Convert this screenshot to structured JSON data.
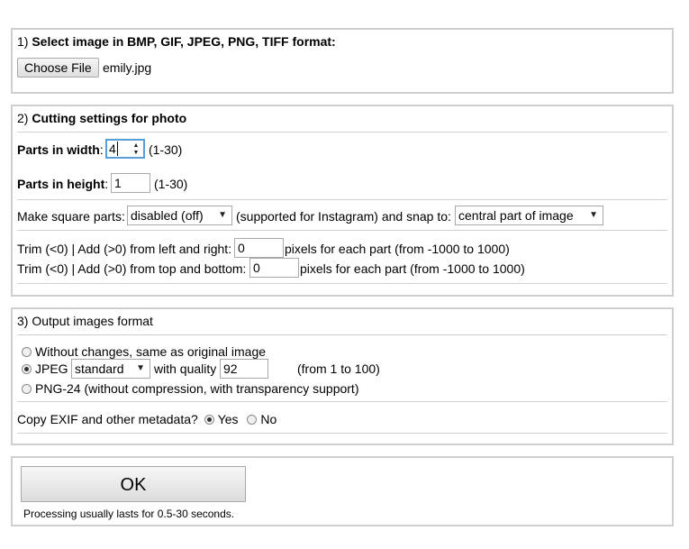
{
  "section1": {
    "num": "1)",
    "title": "Select image in BMP, GIF, JPEG, PNG, TIFF format:",
    "choose_button": "Choose File",
    "file_name": "emily.jpg"
  },
  "section2": {
    "num": "2)",
    "title": "Cutting settings for photo",
    "width_label": "Parts in width",
    "width_value": "4",
    "width_range": "(1-30)",
    "height_label": "Parts in height",
    "height_value": "1",
    "height_range": "(1-30)",
    "square_label": "Make square parts:",
    "square_value": "disabled (off)",
    "square_note": "(supported for Instagram) and snap to:",
    "snap_value": "central part of image",
    "trim_lr_label": "Trim (<0) | Add (>0) from left and right:",
    "trim_lr_value": "0",
    "trim_lr_suffix": "pixels for each part (from -1000 to 1000)",
    "trim_tb_label": "Trim (<0) | Add (>0) from top and bottom:",
    "trim_tb_value": "0",
    "trim_tb_suffix": "pixels for each part (from -1000 to 1000)"
  },
  "section3": {
    "title": "3) Output images format",
    "opt_original": "Without changes, same as original image",
    "opt_jpeg": "JPEG",
    "jpeg_mode": "standard",
    "quality_label": "with quality",
    "quality_value": "92",
    "quality_range": "(from 1 to 100)",
    "opt_png": "PNG-24 (without compression, with transparency support)",
    "exif_label": "Copy EXIF and other metadata?",
    "exif_yes": "Yes",
    "exif_no": "No"
  },
  "submit": {
    "ok_label": "OK",
    "note": "Processing usually lasts for 0.5-30 seconds."
  }
}
